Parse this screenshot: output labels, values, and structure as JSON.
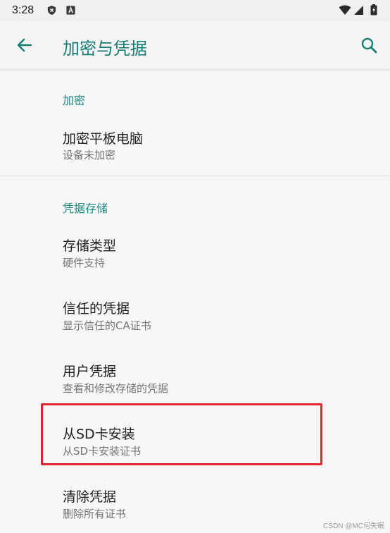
{
  "status_bar": {
    "time": "3:28",
    "icons": [
      "shield-x-icon",
      "a-square-icon",
      "wifi-icon",
      "signal-icon",
      "battery-icon"
    ]
  },
  "app_bar": {
    "title": "加密与凭据",
    "back_icon": "arrow-back-icon",
    "search_icon": "search-icon"
  },
  "sections": [
    {
      "header": "加密",
      "items": [
        {
          "title": "加密平板电脑",
          "summary": "设备未加密"
        }
      ]
    },
    {
      "header": "凭据存储",
      "items": [
        {
          "title": "存储类型",
          "summary": "硬件支持"
        },
        {
          "title": "信任的凭据",
          "summary": "显示信任的CA证书"
        },
        {
          "title": "用户凭据",
          "summary": "查看和修改存储的凭据"
        },
        {
          "title": "从SD卡安装",
          "summary": "从SD卡安装证书"
        },
        {
          "title": "清除凭据",
          "summary": "删除所有证书"
        }
      ]
    }
  ],
  "highlight_color": "#e4252d",
  "accent_color": "#167c73",
  "watermark": "CSDN @MC何失眠"
}
